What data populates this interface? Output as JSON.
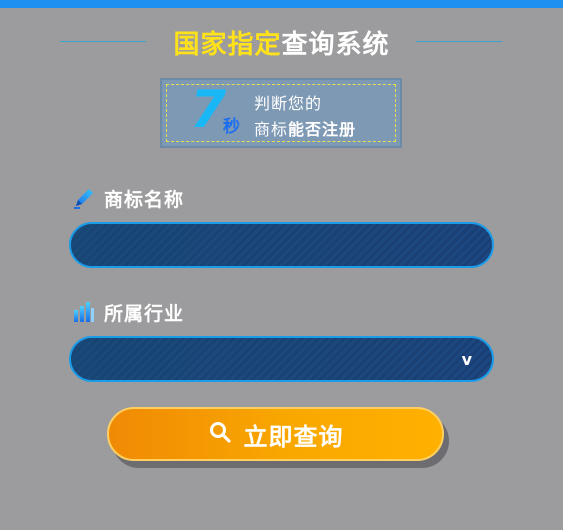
{
  "header": {
    "title_highlight": "国家指定",
    "title_rest": "查询系统"
  },
  "badge": {
    "number": "7",
    "unit": "秒",
    "line1": "判断您的",
    "line2_prefix": "商标",
    "line2_bold": "能否注册"
  },
  "form": {
    "trademark": {
      "label": "商标名称",
      "value": "",
      "placeholder": "",
      "icon": "pen-icon"
    },
    "industry": {
      "label": "所属行业",
      "selected": "",
      "icon": "bar-chart-icon",
      "chevron": "v"
    }
  },
  "actions": {
    "query_label": "立即查询",
    "query_icon": "search-icon"
  },
  "colors": {
    "background": "#9c9b9d",
    "accent_blue": "#1e90f0",
    "title_yellow": "#ffe21a",
    "button_orange": "#f9a800"
  }
}
